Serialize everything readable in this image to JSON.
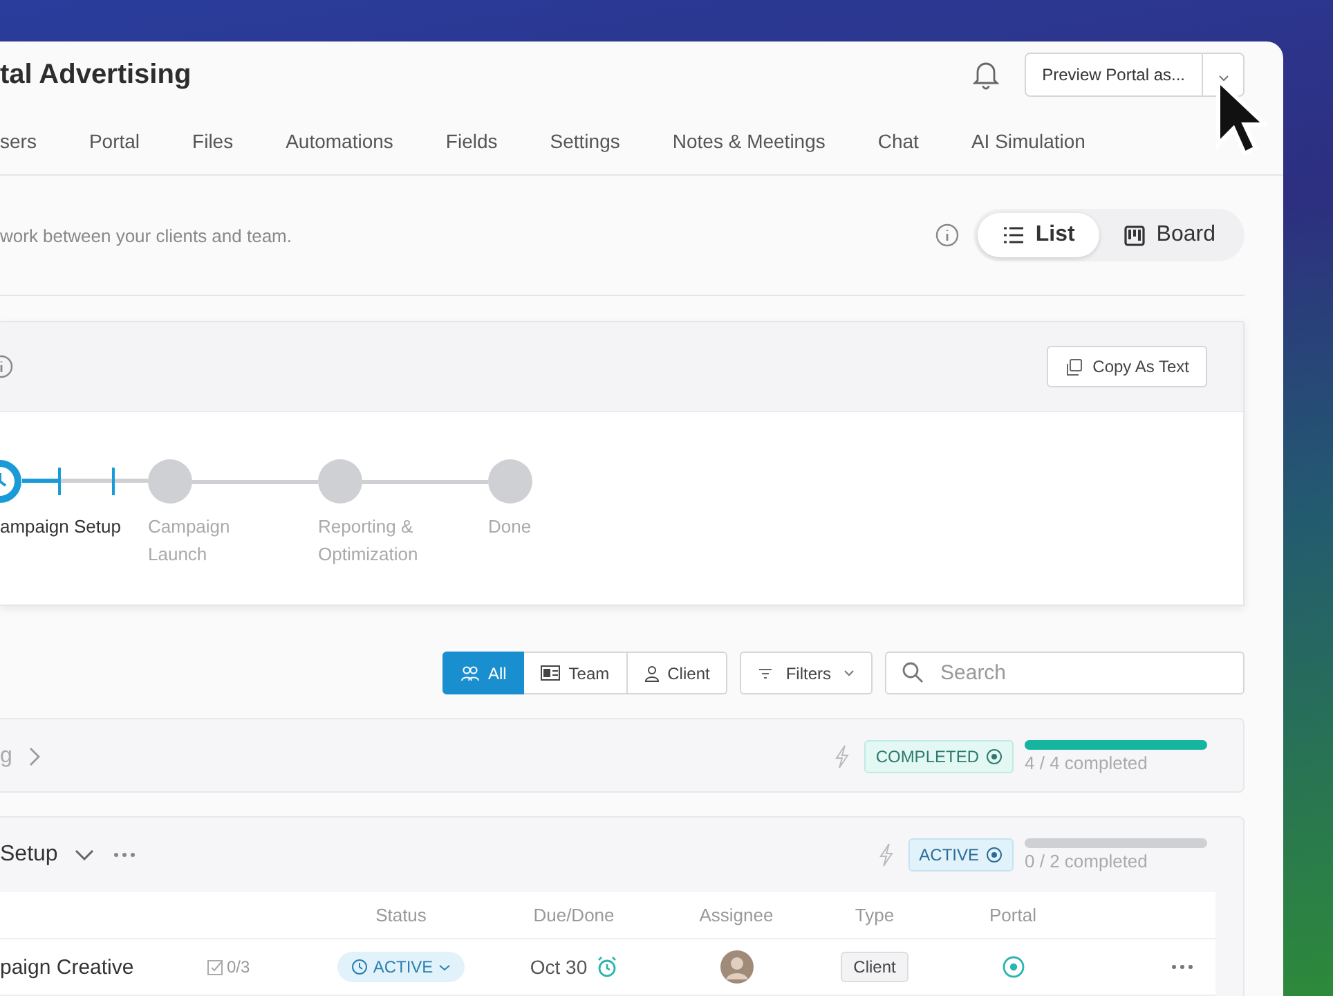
{
  "title": "tal Advertising",
  "preview_button": {
    "label": "Preview Portal as..."
  },
  "nav_tabs": [
    {
      "label": "sers"
    },
    {
      "label": "Portal"
    },
    {
      "label": "Files"
    },
    {
      "label": "Automations"
    },
    {
      "label": "Fields"
    },
    {
      "label": "Settings"
    },
    {
      "label": "Notes & Meetings"
    },
    {
      "label": "Chat"
    },
    {
      "label": "AI Simulation"
    }
  ],
  "description": "work between your clients and team.",
  "view_toggle": [
    {
      "label": "List",
      "selected": true
    },
    {
      "label": "Board",
      "selected": false
    }
  ],
  "stages_card": {
    "copy_button": "Copy As Text",
    "steps": [
      {
        "label": "ampaign Setup",
        "active": true,
        "level": 0.3
      },
      {
        "label": "Campaign Launch",
        "active": false
      },
      {
        "label": "Reporting & Optimization",
        "active": false
      },
      {
        "label": "Done",
        "active": false
      }
    ]
  },
  "toolbar": {
    "audience": [
      {
        "label": "All",
        "selected": true
      },
      {
        "label": "Team",
        "selected": false
      },
      {
        "label": "Client",
        "selected": false
      }
    ],
    "filters_button": "Filters",
    "search": {
      "placeholder": "Search"
    }
  },
  "groups": [
    {
      "title": "g",
      "expanded": false,
      "status": "COMPLETED",
      "completed": true,
      "progress": {
        "level": 1,
        "text": "4 / 4 completed"
      }
    },
    {
      "title": "Setup",
      "expanded": true,
      "status": "ACTIVE",
      "completed": false,
      "progress": {
        "level": 0,
        "text": "0 / 2 completed"
      },
      "table": {
        "columns": [
          "Status",
          "Due/Done",
          "Assignee",
          "Type",
          "Portal"
        ],
        "rows": [
          {
            "name": "paign Creative",
            "checklist": "0/3",
            "status": "ACTIVE",
            "due": "Oct 30",
            "type": "Client",
            "portal": true
          }
        ]
      }
    }
  ]
}
